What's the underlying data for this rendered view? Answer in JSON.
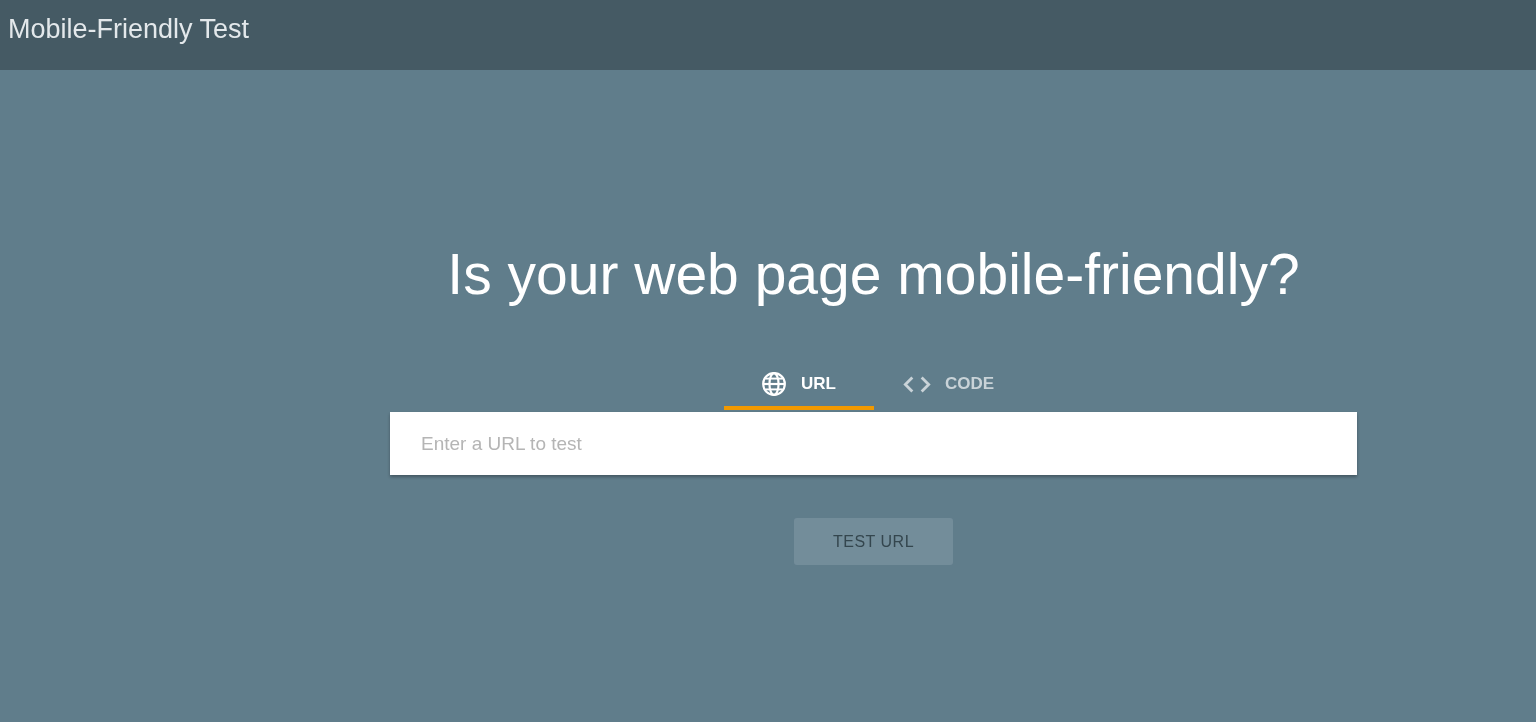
{
  "header": {
    "title": "Mobile-Friendly Test"
  },
  "heading": "Is your web page mobile-friendly?",
  "tabs": [
    {
      "label": "URL",
      "kind": "url",
      "selected": true
    },
    {
      "label": "CODE",
      "kind": "code",
      "selected": false
    }
  ],
  "url_field": {
    "placeholder": "Enter a URL to test"
  },
  "test_button": {
    "label": "TEST URL",
    "disabled": true
  }
}
